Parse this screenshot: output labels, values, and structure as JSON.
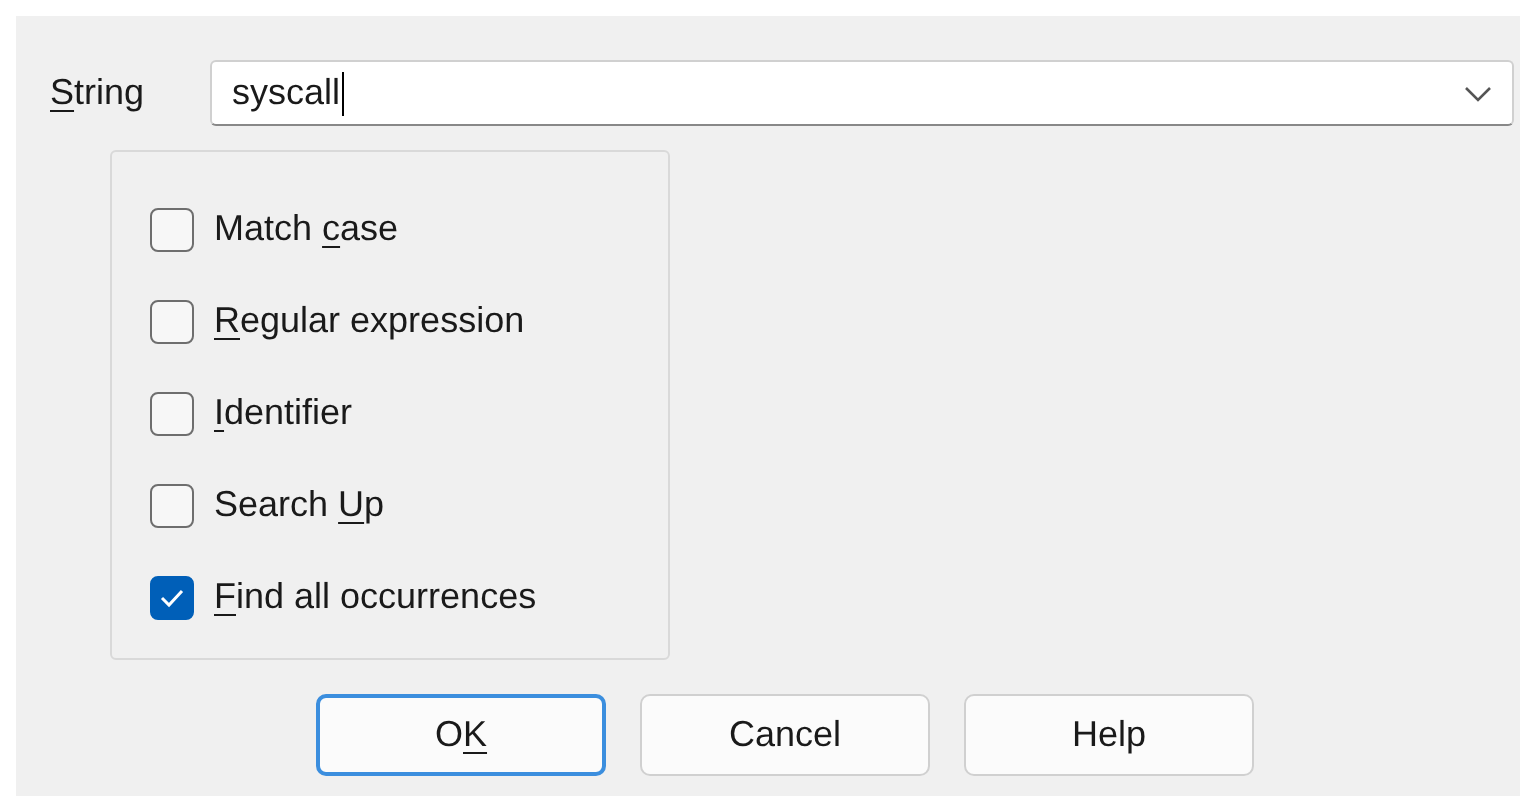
{
  "string_field": {
    "label": {
      "key": "S",
      "after": "tring"
    },
    "value": "syscall"
  },
  "options": [
    {
      "label": {
        "before": "Match ",
        "key": "c",
        "after": "ase"
      },
      "checked": false
    },
    {
      "label": {
        "key": "R",
        "after": "egular expression"
      },
      "checked": false
    },
    {
      "label": {
        "key": "I",
        "after": "dentifier"
      },
      "checked": false
    },
    {
      "label": {
        "before": "Search ",
        "key": "U",
        "after": "p"
      },
      "checked": false
    },
    {
      "label": {
        "key": "F",
        "after": "ind all occurrences"
      },
      "checked": true
    }
  ],
  "buttons": [
    {
      "label": {
        "before": "O",
        "key": "K"
      },
      "default": true
    },
    {
      "label": {
        "before": "Cancel"
      },
      "default": false
    },
    {
      "label": {
        "before": "Help"
      },
      "default": false
    }
  ]
}
